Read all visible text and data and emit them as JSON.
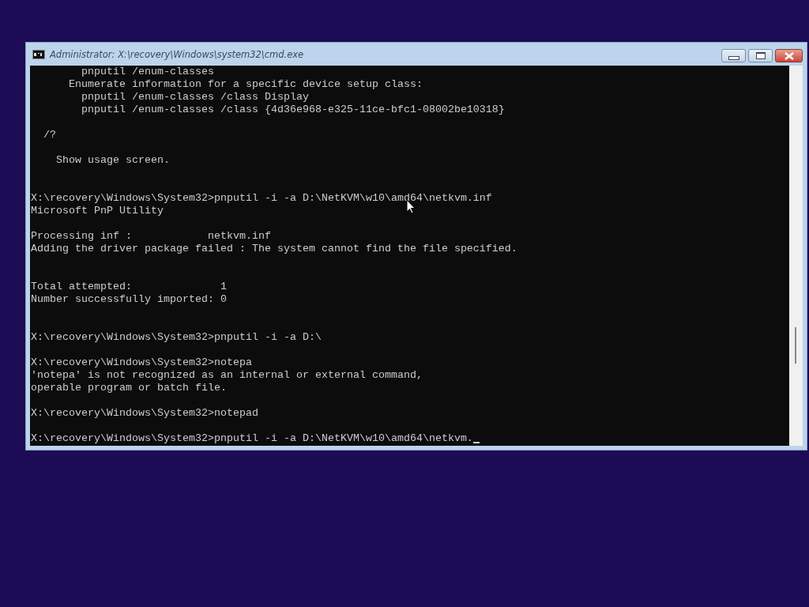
{
  "window": {
    "title": "Administrator: X:\\recovery\\Windows\\system32\\cmd.exe"
  },
  "console": {
    "lines": [
      {
        "kind": "text",
        "text": "        pnputil /enum-classes"
      },
      {
        "kind": "text",
        "text": "      Enumerate information for a specific device setup class:"
      },
      {
        "kind": "text",
        "text": "        pnputil /enum-classes /class Display"
      },
      {
        "kind": "text",
        "text": "        pnputil /enum-classes /class {4d36e968-e325-11ce-bfc1-08002be10318}"
      },
      {
        "kind": "blank"
      },
      {
        "kind": "text",
        "text": "  /?"
      },
      {
        "kind": "blank"
      },
      {
        "kind": "text",
        "text": "    Show usage screen."
      },
      {
        "kind": "blank"
      },
      {
        "kind": "blank"
      },
      {
        "kind": "text",
        "text": "X:\\recovery\\Windows\\System32>pnputil -i -a D:\\NetKVM\\w10\\amd64\\netkvm.inf"
      },
      {
        "kind": "text",
        "text": "Microsoft PnP Utility"
      },
      {
        "kind": "blank"
      },
      {
        "kind": "text",
        "text": "Processing inf :            netkvm.inf"
      },
      {
        "kind": "text",
        "text": "Adding the driver package failed : The system cannot find the file specified."
      },
      {
        "kind": "blank"
      },
      {
        "kind": "blank"
      },
      {
        "kind": "text",
        "text": "Total attempted:              1"
      },
      {
        "kind": "text",
        "text": "Number successfully imported: 0"
      },
      {
        "kind": "blank"
      },
      {
        "kind": "blank"
      },
      {
        "kind": "text",
        "text": "X:\\recovery\\Windows\\System32>pnputil -i -a D:\\"
      },
      {
        "kind": "blank"
      },
      {
        "kind": "text",
        "text": "X:\\recovery\\Windows\\System32>notepa"
      },
      {
        "kind": "text",
        "text": "'notepa' is not recognized as an internal or external command,"
      },
      {
        "kind": "text",
        "text": "operable program or batch file."
      },
      {
        "kind": "blank"
      },
      {
        "kind": "text",
        "text": "X:\\recovery\\Windows\\System32>notepad"
      },
      {
        "kind": "blank"
      },
      {
        "kind": "text",
        "text": "X:\\recovery\\Windows\\System32>pnputil -i -a D:\\NetKVM\\w10\\amd64\\netkvm.",
        "caret": true
      }
    ]
  }
}
